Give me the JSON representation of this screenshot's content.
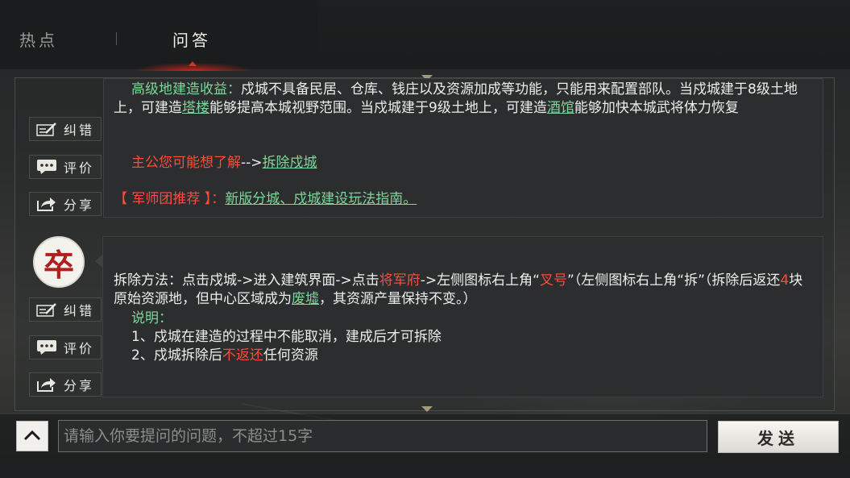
{
  "tabs": [
    {
      "label": "热点",
      "active": false
    },
    {
      "label": "问答",
      "active": true
    }
  ],
  "actions": {
    "correct": "纠错",
    "review": "评价",
    "share": "分享"
  },
  "card1": {
    "section_label": "高级地建造收益：",
    "text_a": "戍城不具备民居、仓库、钱庄以及资源加成等功能，只能用来配置部队。当戍城建于8级土地上，可建造",
    "link_tower": "塔楼",
    "text_b": "能够提高本城视野范围。当戍城建于9级土地上，可建造",
    "link_tavern": "酒馆",
    "text_c": "能够加快本城武将体力恢复",
    "maybe_label": "主公您可能想了解",
    "maybe_arrow": "-->",
    "maybe_link": "拆除戍城",
    "recommend_label": "【 军师团推荐 】：",
    "recommend_link": "新版分城、戍城建设玩法指南。"
  },
  "card2": {
    "avatar_char": "卒",
    "p1_a": "拆除方法：点击戍城->进入建筑界面->点击",
    "p1_red1": "将军府",
    "p1_b": "->左侧图标右上角“",
    "p1_red2": "叉号",
    "p1_c": "”（左侧图标右上角“拆”（拆除后返还",
    "p1_red3": "4",
    "p1_d": "块原始资源地，但中心区域成为",
    "p1_link": "废墟",
    "p1_e": "，其资源产量保持不变。）",
    "note_label": "说明：",
    "note1": "1、戍城在建造的过程中不能取消，建成后才可拆除",
    "note2_a": "2、戍城拆除后",
    "note2_red": "不返还",
    "note2_b": "任何资源"
  },
  "input": {
    "placeholder": "请输入你要提问的问题，不超过15字",
    "value": ""
  },
  "send_label": "发送",
  "icons": [
    "edit-icon",
    "comment-icon",
    "share-icon",
    "chevron-up-icon"
  ],
  "colors": {
    "highlight_green": "#7ed79a",
    "highlight_red": "#ff4b3a",
    "tab_glow": "#d9302a"
  }
}
